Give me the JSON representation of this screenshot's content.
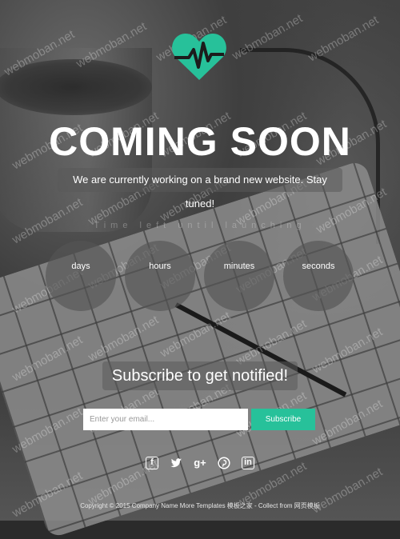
{
  "brand": {
    "accent": "#27c19a"
  },
  "hero": {
    "title": "COMING SOON",
    "subtitle": "We are currently working on a brand new website. Stay tuned!",
    "launch_label": "Time left until launching"
  },
  "countdown": [
    {
      "label": "days"
    },
    {
      "label": "hours"
    },
    {
      "label": "minutes"
    },
    {
      "label": "seconds"
    }
  ],
  "subscribe": {
    "heading": "Subscribe to get notified!",
    "email_placeholder": "Enter your email...",
    "button_label": "Subscribe"
  },
  "social": [
    "facebook-icon",
    "twitter-icon",
    "google-plus-icon",
    "pinterest-icon",
    "linkedin-icon"
  ],
  "footer": {
    "text": "Copyright © 2015 Company Name  More Templates 模板之家 - Collect from 网页模板"
  },
  "watermark": "webmoban.net"
}
